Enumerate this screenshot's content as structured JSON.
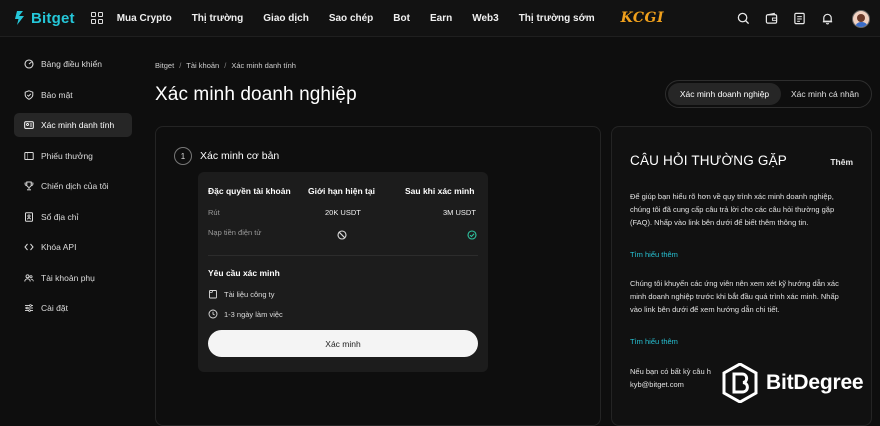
{
  "brand": {
    "name": "Bitget",
    "partner": "KCGI"
  },
  "nav": [
    "Mua Crypto",
    "Thị trường",
    "Giao dịch",
    "Sao chép",
    "Bot",
    "Earn",
    "Web3",
    "Thị trường sớm"
  ],
  "top_icons": [
    "search-icon",
    "wallet-icon",
    "orders-icon",
    "bell-icon",
    "avatar"
  ],
  "sidebar": [
    {
      "label": "Bảng điều khiển",
      "icon": "dashboard-icon",
      "active": false
    },
    {
      "label": "Bảo mật",
      "icon": "shield-icon",
      "active": false
    },
    {
      "label": "Xác minh danh tính",
      "icon": "id-card-icon",
      "active": true
    },
    {
      "label": "Phiếu thưởng",
      "icon": "coupon-icon",
      "active": false
    },
    {
      "label": "Chiến dịch của tôi",
      "icon": "trophy-icon",
      "active": false
    },
    {
      "label": "Sổ địa chỉ",
      "icon": "address-book-icon",
      "active": false
    },
    {
      "label": "Khóa API",
      "icon": "api-icon",
      "active": false
    },
    {
      "label": "Tài khoản phụ",
      "icon": "sub-account-icon",
      "active": false
    },
    {
      "label": "Cài đặt",
      "icon": "settings-icon",
      "active": false
    }
  ],
  "breadcrumb": [
    "Bitget",
    "Tài khoản",
    "Xác minh danh tính"
  ],
  "breadcrumb_sep": "/",
  "page_title": "Xác minh doanh nghiệp",
  "segment": {
    "business": "Xác minh doanh nghiệp",
    "personal": "Xác minh cá nhân"
  },
  "step": {
    "number": "1",
    "title": "Xác minh cơ bản"
  },
  "table": {
    "headers": [
      "Đặc quyền tài khoản",
      "Giới hạn hiện tại",
      "Sau khi xác minh"
    ],
    "rows": [
      {
        "label": "Rút",
        "current": "20K USDT",
        "after": "3M USDT"
      },
      {
        "label": "Nạp tiền điện tử",
        "current_icon": "blocked-icon",
        "after_icon": "check-circle-icon"
      }
    ]
  },
  "requirements": {
    "title": "Yêu cầu xác minh",
    "items": [
      {
        "icon": "document-icon",
        "label": "Tài liệu công ty"
      },
      {
        "icon": "clock-icon",
        "label": "1-3 ngày làm việc"
      }
    ]
  },
  "verify_button": "Xác minh",
  "faq": {
    "title": "CÂU HỎI THƯỜNG GẶP",
    "more": "Thêm",
    "p1": "Để giúp bạn hiểu rõ hơn về quy trình xác minh doanh nghiệp, chúng tôi đã cung cấp câu trả lời cho các câu hỏi thường gặp (FAQ). Nhấp vào link bên dưới để biết thêm thông tin.",
    "link1": "Tìm hiểu thêm",
    "p2": "Chúng tôi khuyến các ứng viên nên xem xét kỹ hướng dẫn xác minh doanh nghiệp trước khi bắt đầu quá trình xác minh. Nhấp vào link bên dưới để xem hướng dẫn chi tiết.",
    "link2": "Tìm hiểu thêm",
    "p3a": "Nếu bạn có bất kỳ câu h",
    "p3b": "kyb@bitget.com"
  },
  "watermark": "BitDegree",
  "colors": {
    "accent": "#25c7d9",
    "success": "#2ec4a0",
    "kcgi": "#f0a01c"
  }
}
